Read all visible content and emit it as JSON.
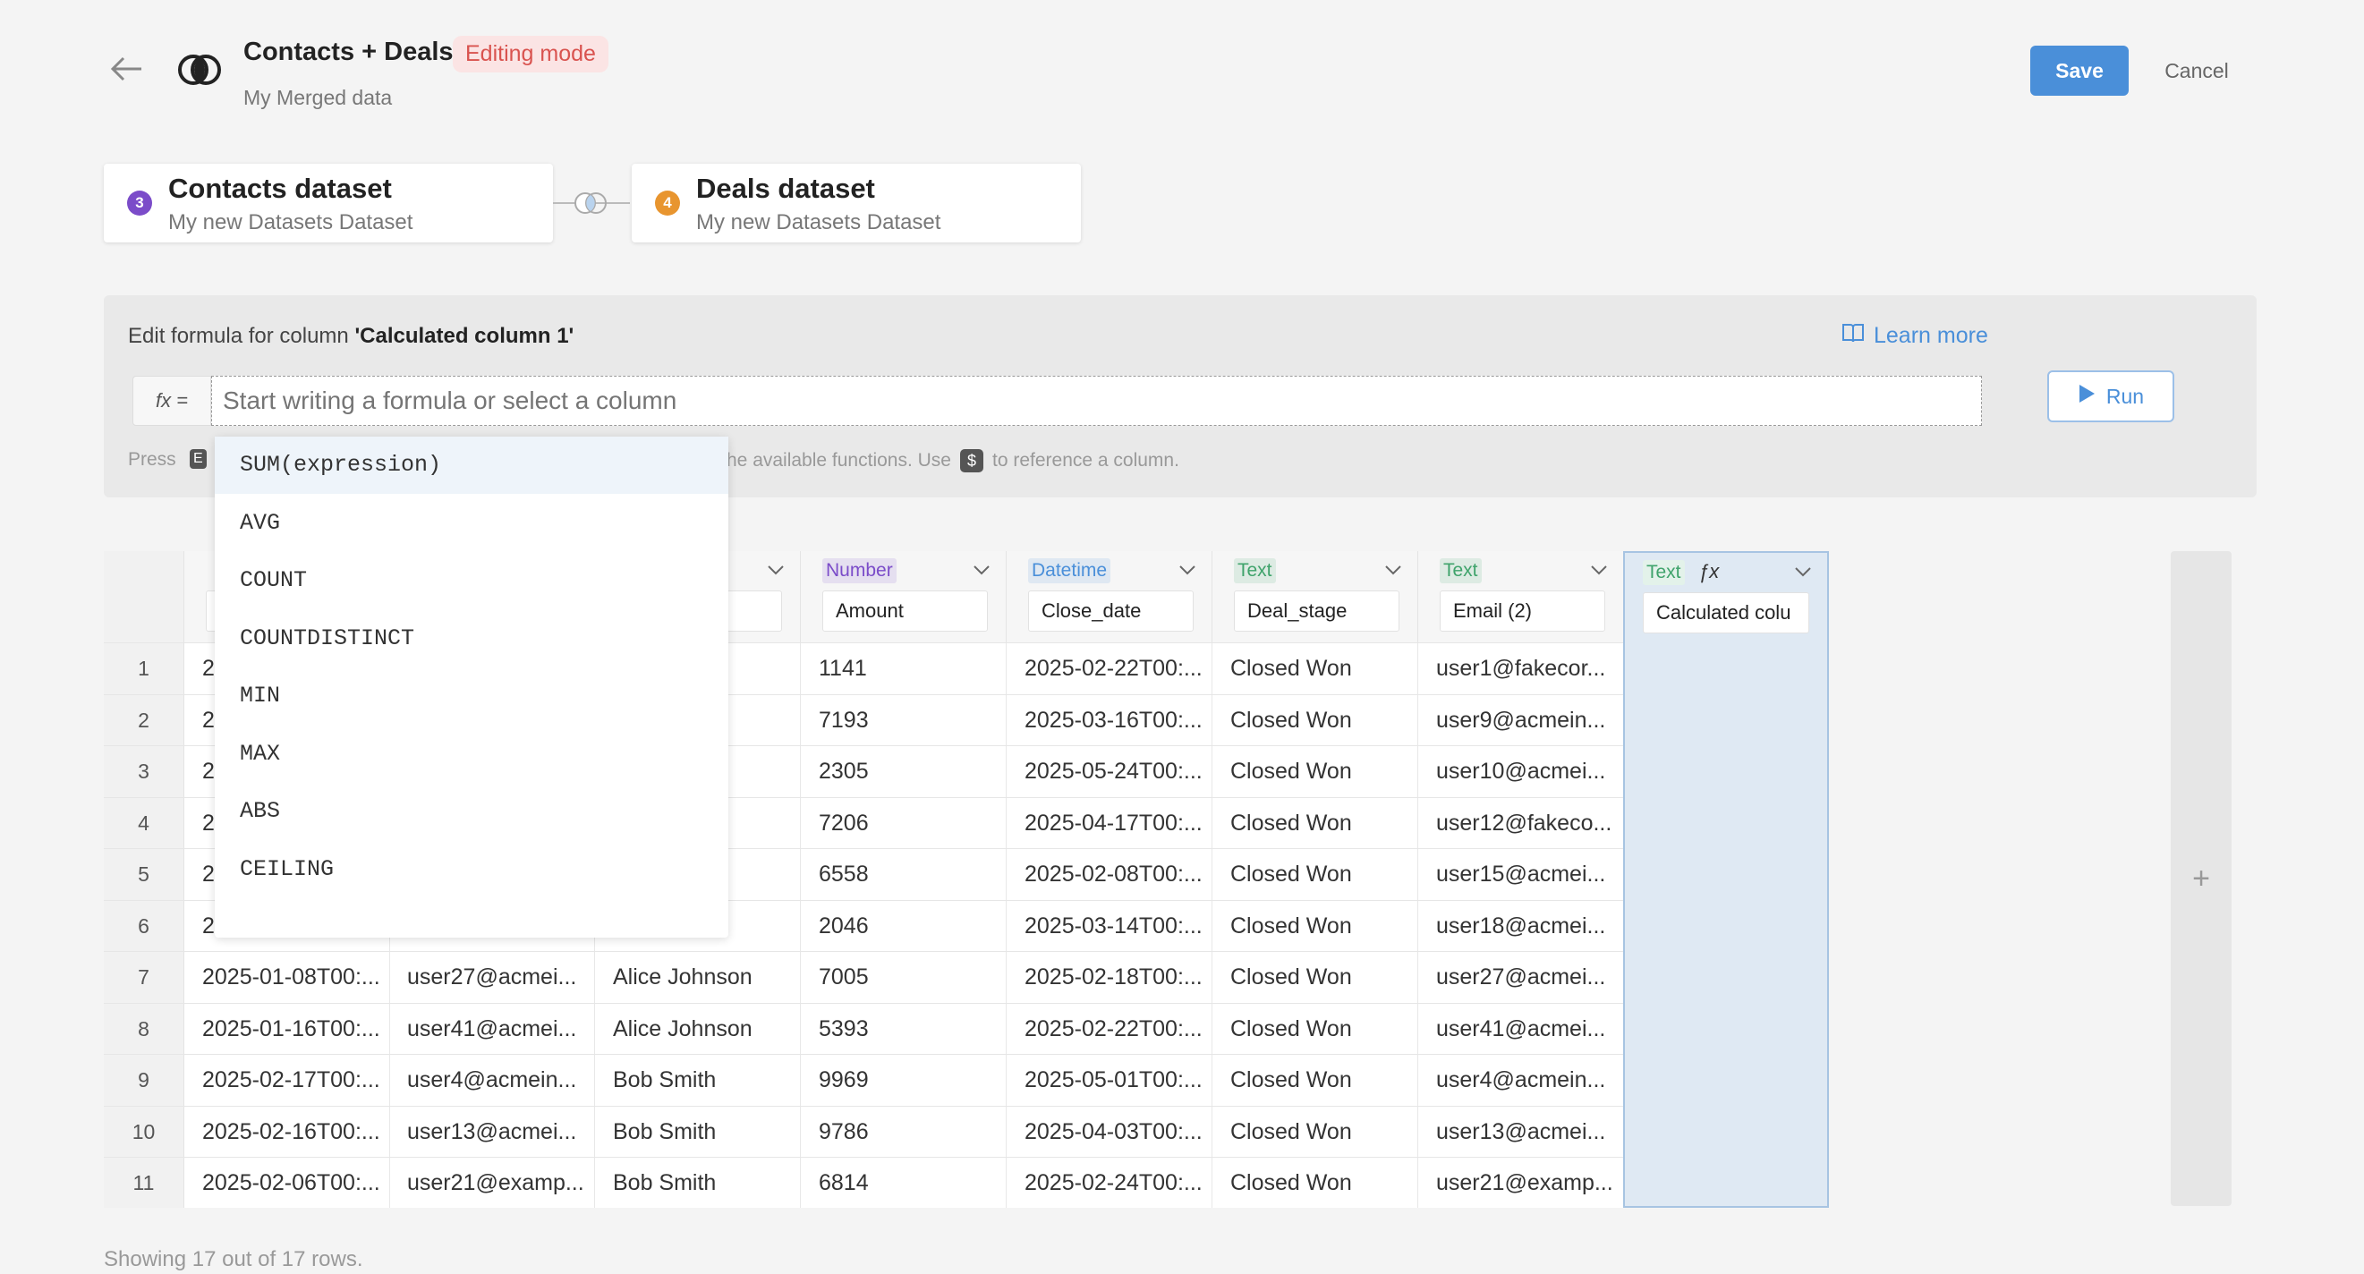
{
  "header": {
    "title": "Contacts + Deals",
    "badge": "Editing mode",
    "subtitle": "My Merged data",
    "save_label": "Save",
    "cancel_label": "Cancel"
  },
  "datasets": [
    {
      "number": "3",
      "title": "Contacts dataset",
      "subtitle": "My new Datasets Dataset",
      "color": "#7b4cc9"
    },
    {
      "number": "4",
      "title": "Deals dataset",
      "subtitle": "My new Datasets Dataset",
      "color": "#e8952f"
    }
  ],
  "formula": {
    "edit_prefix": "Edit formula for column ",
    "column_name": "'Calculated column 1'",
    "learn_more": "Learn more",
    "fx_label": "fx =",
    "placeholder": "Start writing a formula or select a column",
    "run_label": "Run",
    "help_start": "Press",
    "help_key": "E",
    "help_mid": "he available functions. Use",
    "help_dollar": "$",
    "help_end": "to reference a column."
  },
  "autocomplete": [
    "SUM(expression)",
    "AVG",
    "COUNT",
    "COUNTDISTINCT",
    "MIN",
    "MAX",
    "ABS",
    "CEILING"
  ],
  "columns": [
    {
      "type": "",
      "name": "",
      "type_color": ""
    },
    {
      "type": "",
      "name": "",
      "type_color": ""
    },
    {
      "type": "",
      "name": "wn",
      "type_color": ""
    },
    {
      "type": "Number",
      "name": "Amount",
      "type_color": "#7b4cc9"
    },
    {
      "type": "Datetime",
      "name": "Close_date",
      "type_color": "#4a8fd9"
    },
    {
      "type": "Text",
      "name": "Deal_stage",
      "type_color": "#3fa36b"
    },
    {
      "type": "Text",
      "name": "Email (2)",
      "type_color": "#3fa36b"
    },
    {
      "type": "Text",
      "name": "Calculated colu",
      "type_color": "#3fa36b"
    }
  ],
  "rows": [
    {
      "n": "1",
      "c": [
        "2",
        "",
        "on",
        "1141",
        "2025-02-22T00:...",
        "Closed Won",
        "user1@fakecor..."
      ]
    },
    {
      "n": "2",
      "c": [
        "2",
        "",
        "on",
        "7193",
        "2025-03-16T00:...",
        "Closed Won",
        "user9@acmein..."
      ]
    },
    {
      "n": "3",
      "c": [
        "2",
        "",
        "on",
        "2305",
        "2025-05-24T00:...",
        "Closed Won",
        "user10@acmei..."
      ]
    },
    {
      "n": "4",
      "c": [
        "2",
        "",
        "on",
        "7206",
        "2025-04-17T00:...",
        "Closed Won",
        "user12@fakeco..."
      ]
    },
    {
      "n": "5",
      "c": [
        "2",
        "",
        "on",
        "6558",
        "2025-02-08T00:...",
        "Closed Won",
        "user15@acmei..."
      ]
    },
    {
      "n": "6",
      "c": [
        "2",
        "",
        "on",
        "2046",
        "2025-03-14T00:...",
        "Closed Won",
        "user18@acmei..."
      ]
    },
    {
      "n": "7",
      "c": [
        "2025-01-08T00:...",
        "user27@acmei...",
        "Alice Johnson",
        "7005",
        "2025-02-18T00:...",
        "Closed Won",
        "user27@acmei..."
      ]
    },
    {
      "n": "8",
      "c": [
        "2025-01-16T00:...",
        "user41@acmei...",
        "Alice Johnson",
        "5393",
        "2025-02-22T00:...",
        "Closed Won",
        "user41@acmei..."
      ]
    },
    {
      "n": "9",
      "c": [
        "2025-02-17T00:...",
        "user4@acmein...",
        "Bob Smith",
        "9969",
        "2025-05-01T00:...",
        "Closed Won",
        "user4@acmein..."
      ]
    },
    {
      "n": "10",
      "c": [
        "2025-02-16T00:...",
        "user13@acmei...",
        "Bob Smith",
        "9786",
        "2025-04-03T00:...",
        "Closed Won",
        "user13@acmei..."
      ]
    },
    {
      "n": "11",
      "c": [
        "2025-02-06T00:...",
        "user21@examp...",
        "Bob Smith",
        "6814",
        "2025-02-24T00:...",
        "Closed Won",
        "user21@examp..."
      ]
    }
  ],
  "footer": {
    "showing": "Showing 17 out of 17 rows."
  },
  "add_column": "+"
}
